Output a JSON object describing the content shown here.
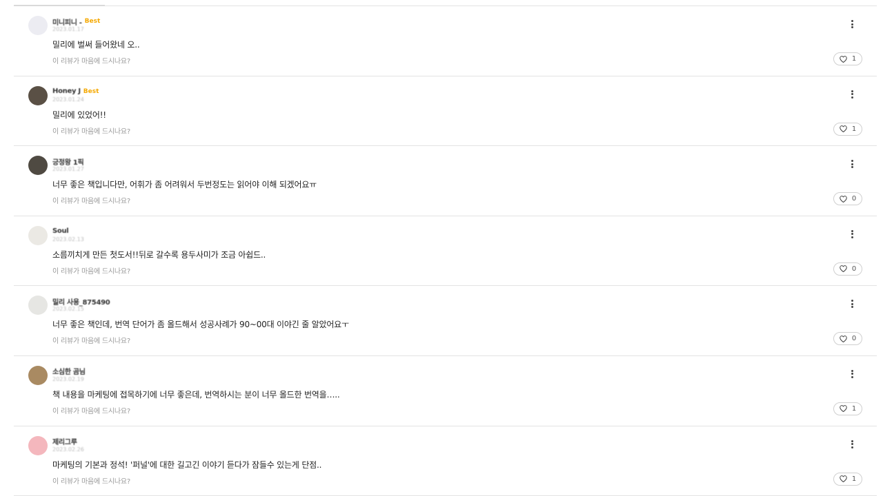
{
  "reviews": [
    {
      "nickname": "미니피니 -",
      "badge": "Best",
      "date": "2023.01.17",
      "text": "밀리에 벌써 들어왔네 오..",
      "prompt": "이 리뷰가 마음에 드시나요?",
      "likes": "1",
      "avatar_color": "#ececf2"
    },
    {
      "nickname": "Honey J",
      "badge": "Best",
      "date": "2023.01.24",
      "text": "밀리에 있었어!!",
      "prompt": "이 리뷰가 마음에 드시나요?",
      "likes": "1",
      "avatar_color": "#5a5045"
    },
    {
      "nickname": "긍정왕 1픽",
      "badge": "",
      "date": "2023.01.27",
      "text": "너무 좋은 책입니다만, 어휘가 좀 어려워서 두번정도는 읽어야 이해 되겠어요ㅠ",
      "prompt": "이 리뷰가 마음에 드시나요?",
      "likes": "0",
      "avatar_color": "#4f4a42"
    },
    {
      "nickname": "Soul",
      "badge": "",
      "date": "2023.02.13",
      "text": "소름끼치게 만든 첫도서!!뒤로 갈수록 용두사미가 조금 아쉽드..",
      "prompt": "이 리뷰가 마음에 드시나요?",
      "likes": "0",
      "avatar_color": "#ebe9e4"
    },
    {
      "nickname": "밀리 사용_875490",
      "badge": "",
      "date": "2023.02.15",
      "text": "너무 좋은 책인데, 번역 단어가 좀 올드해서 성공사례가 90~00대 이야긴 줄 알았어요ㅜ",
      "prompt": "이 리뷰가 마음에 드시나요?",
      "likes": "0",
      "avatar_color": "#e6e6e3"
    },
    {
      "nickname": "소심한 곰님",
      "badge": "",
      "date": "2023.02.19",
      "text": "책 내용을 마케팅에 접목하기에 너무 좋은데, 번역하시는 분이 너무 올드한 번역을…..",
      "prompt": "이 리뷰가 마음에 드시나요?",
      "likes": "1",
      "avatar_color": "#a98a62"
    },
    {
      "nickname": "제리그루",
      "badge": "",
      "date": "2023.02.26",
      "text": "마케팅의 기본과 정석! '퍼널'에 대한 길고긴 이야기 듣다가 잠들수 있는게 단점..",
      "prompt": "이 리뷰가 마음에 드시나요?",
      "likes": "1",
      "avatar_color": "#f4b7bd"
    }
  ],
  "icons": {
    "more": "more-vertical-icon",
    "like": "heart-outline-icon"
  },
  "colors": {
    "badge": "#f5a800",
    "divider": "#e3e3e3",
    "text": "#222222",
    "muted": "#999999"
  }
}
